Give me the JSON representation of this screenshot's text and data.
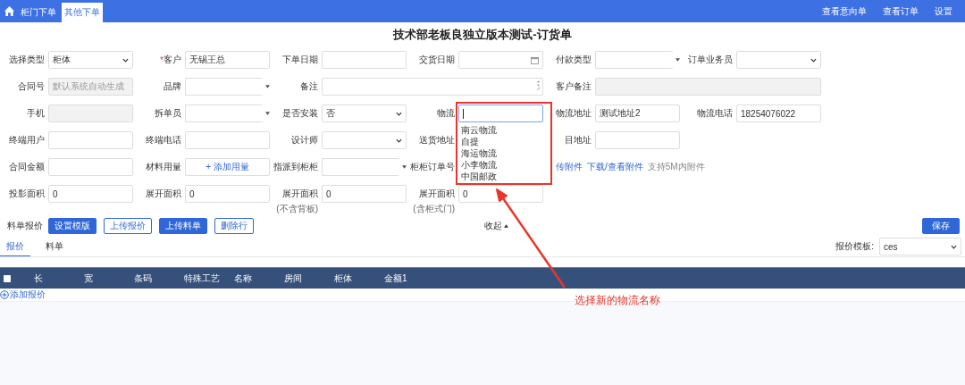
{
  "header": {
    "tabs": [
      {
        "label": "柜门下单",
        "selected": false
      },
      {
        "label": "其他下单",
        "selected": true
      }
    ],
    "links": [
      "查看意向单",
      "查看订单",
      "设置"
    ]
  },
  "title": "技术部老板良独立版本测试-订货单",
  "form_rows": [
    [
      {
        "label": "选择类型",
        "kind": "select",
        "value": "柜体"
      },
      {
        "label": "客户",
        "required_mark": "*",
        "kind": "input",
        "value": "无锡王总"
      },
      {
        "label": "下单日期",
        "kind": "input"
      },
      {
        "label": "交货日期",
        "kind": "date"
      },
      {
        "label": "付款类型",
        "kind": "combo"
      },
      {
        "label": "订单业务员",
        "kind": "select"
      }
    ],
    [
      {
        "label": "合同号",
        "kind": "disabled",
        "placeholder": "默认系统自动生成"
      },
      {
        "label": "品牌",
        "kind": "combo"
      },
      {
        "label": "备注",
        "kind": "textarea"
      },
      {
        "label": "客户备注",
        "kind": "wide"
      }
    ],
    [
      {
        "label": "手机",
        "kind": "disabled"
      },
      {
        "label": "拆单员",
        "kind": "combo"
      },
      {
        "label": "是否安装",
        "kind": "select",
        "value": "否"
      },
      {
        "label": "物流",
        "kind": "focused",
        "options": [
          "南云物流",
          "自提",
          "海运物流",
          "小李物流",
          "中国邮政"
        ]
      },
      {
        "label": "物流地址",
        "kind": "input",
        "value": "测试地址2"
      },
      {
        "label": "物流电话",
        "kind": "input",
        "value": "18254076022"
      }
    ],
    [
      {
        "label": "终端用户",
        "kind": "input"
      },
      {
        "label": "终端电话",
        "kind": "input"
      },
      {
        "label": "设计师",
        "kind": "select"
      },
      {
        "label": "送货地址",
        "kind": "label-only"
      },
      {
        "label": "目地址",
        "kind": "input"
      }
    ],
    [
      {
        "label": "合同金额",
        "kind": "input"
      },
      {
        "label": "材料用量",
        "kind": "add-button",
        "value": "+ 添加用量"
      },
      {
        "label": "指派到柜柜",
        "kind": "combo"
      },
      {
        "label": "柜柜订单号",
        "kind": "label-only"
      },
      {
        "kind": "attachments",
        "links": [
          "传附件",
          "下载/查看附件"
        ],
        "note": "支持5M内附件"
      }
    ],
    [
      {
        "label": "投影面积",
        "kind": "input",
        "value": "0"
      },
      {
        "label": "展开面积",
        "kind": "input",
        "value": "0"
      },
      {
        "label": "展开面积",
        "note": "(不含背板)",
        "kind": "input",
        "value": "0"
      },
      {
        "label": "展开面积",
        "note": "(含柜式门)",
        "kind": "input",
        "value": "0"
      }
    ]
  ],
  "toolbar": {
    "label": "料单报价",
    "buttons": [
      {
        "label": "设置模版",
        "primary": true
      },
      {
        "label": "上传报价",
        "primary": false
      },
      {
        "label": "上传料单",
        "primary": true
      },
      {
        "label": "删除行",
        "primary": false
      }
    ],
    "collapse": "收起",
    "save": "保存"
  },
  "tabs": [
    {
      "label": "报价",
      "selected": true
    },
    {
      "label": "料单",
      "selected": false
    }
  ],
  "template": {
    "label": "报价模板:",
    "value": "ces"
  },
  "table": {
    "select_all_checked": false,
    "columns": [
      "长",
      "宽",
      "条码",
      "特殊工艺",
      "名称",
      "房间",
      "柜体",
      "金额1"
    ],
    "add_link": "添加报价"
  },
  "annotation": {
    "text": "选择新的物流名称"
  }
}
